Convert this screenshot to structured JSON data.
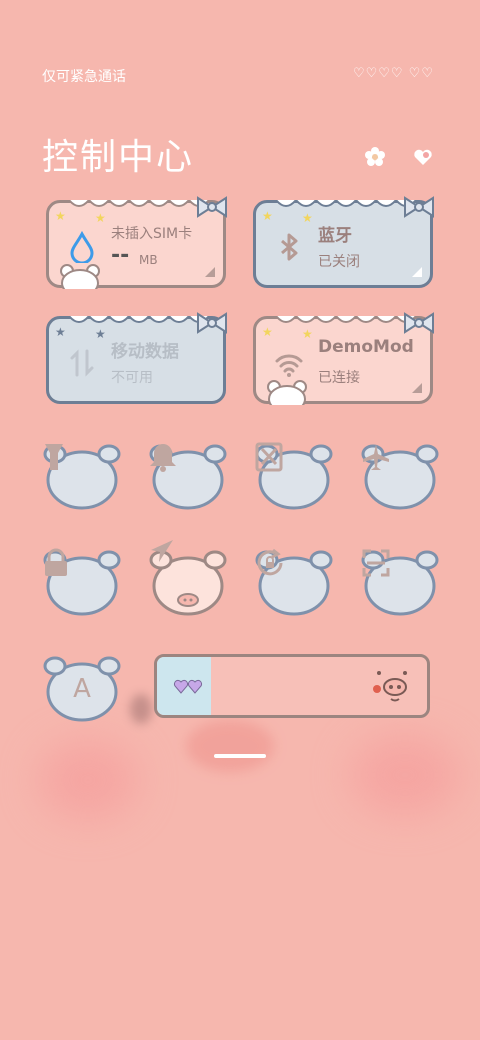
{
  "status": {
    "left_text": "仅可紧急通话",
    "right_deco": "♡♡♡♡ ♡♡"
  },
  "header": {
    "title": "控制中心",
    "icons": [
      "flower-settings-icon",
      "heart-edit-icon"
    ]
  },
  "tiles": {
    "data": {
      "label": "未插入SIM卡",
      "value": "--",
      "unit": "MB",
      "icon": "water-drop-icon"
    },
    "bluetooth": {
      "label": "蓝牙",
      "status": "已关闭",
      "icon": "bluetooth-icon"
    },
    "mobile": {
      "label": "移动数据",
      "status": "不可用",
      "icon": "mobile-data-icon"
    },
    "wifi": {
      "label": "DemoMod",
      "status": "已连接",
      "icon": "wifi-icon"
    }
  },
  "toggles": [
    {
      "id": "flashlight",
      "icon": "flashlight-icon"
    },
    {
      "id": "ring",
      "icon": "bell-icon"
    },
    {
      "id": "screenshot",
      "icon": "scissors-icon"
    },
    {
      "id": "airplane",
      "icon": "airplane-icon"
    },
    {
      "id": "lock",
      "icon": "lock-icon"
    },
    {
      "id": "location",
      "icon": "location-arrow-icon",
      "active": true
    },
    {
      "id": "autorotate",
      "icon": "rotate-lock-icon"
    },
    {
      "id": "scanner",
      "icon": "scan-icon"
    }
  ],
  "font_toggle": {
    "label": "A",
    "icon": "font-icon"
  },
  "brightness": {
    "level": 0.2
  },
  "colors": {
    "background": "#f6b7ae",
    "card_pink": "#fbd6cf",
    "card_blue": "#d7dfe6",
    "button": "#dde3ea",
    "outline": "#8a97ad",
    "icon_brown": "#b59a94"
  }
}
